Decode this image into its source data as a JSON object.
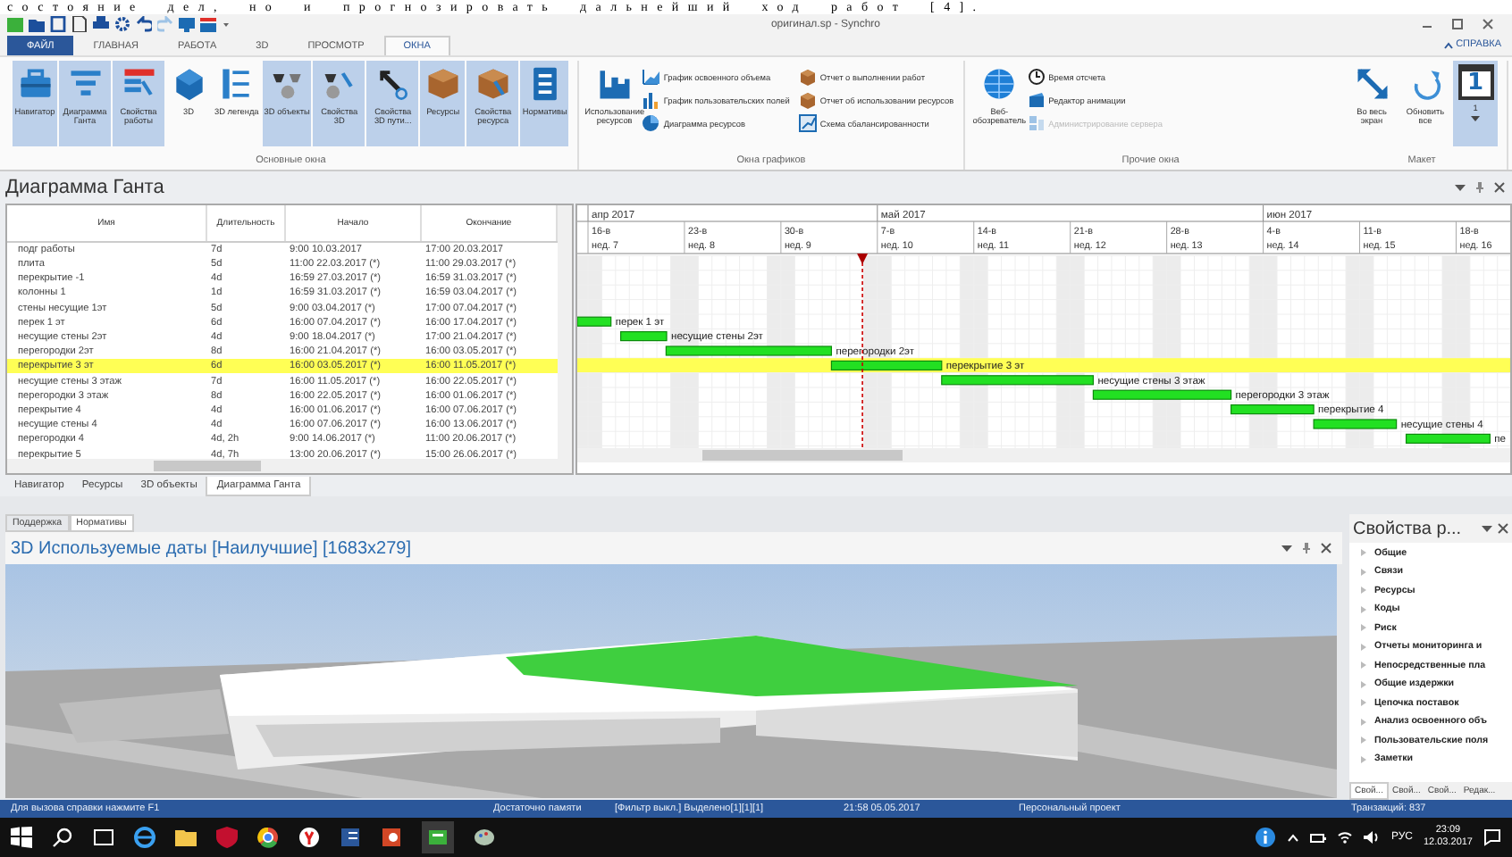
{
  "document_text": "состояние дел, но и прогнозировать дальнейший ход работ [4].",
  "window": {
    "title": "оригинал.sp - Synchro",
    "help": "СПРАВКА"
  },
  "tabs": [
    {
      "label": "ФАЙЛ",
      "kind": "file",
      "selected": false
    },
    {
      "label": "ГЛАВНАЯ",
      "kind": "tab",
      "selected": false
    },
    {
      "label": "РАБОТА",
      "kind": "tab",
      "selected": false
    },
    {
      "label": "3D",
      "kind": "tab",
      "selected": false
    },
    {
      "label": "ПРОСМОТР",
      "kind": "tab",
      "selected": false
    },
    {
      "label": "ОКНА",
      "kind": "tab",
      "selected": true
    }
  ],
  "ribbon": {
    "groups": [
      {
        "title": "Основные окна",
        "buttons": [
          {
            "label": "Навигатор",
            "kind": "large",
            "on": true
          },
          {
            "label": "Диаграмма Ганта",
            "kind": "large",
            "on": true
          },
          {
            "label": "Свойства работы",
            "kind": "large",
            "on": true
          },
          {
            "label": "3D",
            "kind": "large",
            "on": false
          },
          {
            "label": "3D легенда",
            "kind": "large",
            "on": false
          },
          {
            "label": "3D объекты",
            "kind": "large",
            "on": true
          },
          {
            "label": "Свойства 3D",
            "kind": "large",
            "on": true
          },
          {
            "label": "Свойства 3D пути...",
            "kind": "large",
            "on": true
          },
          {
            "label": "Ресурсы",
            "kind": "large",
            "on": true
          },
          {
            "label": "Свойства ресурса",
            "kind": "large",
            "on": true
          },
          {
            "label": "Нормативы",
            "kind": "large",
            "on": true
          }
        ]
      },
      {
        "title": "Окна графиков",
        "buttons": [
          {
            "label": "Использование ресурсов",
            "kind": "large",
            "on": false
          },
          {
            "label": "График освоенного объема",
            "kind": "small",
            "disabled": false
          },
          {
            "label": "График пользовательских полей",
            "kind": "small",
            "disabled": false
          },
          {
            "label": "Диаграмма ресурсов",
            "kind": "small",
            "disabled": false
          },
          {
            "label": "Отчет о выполнении работ",
            "kind": "small",
            "disabled": false
          },
          {
            "label": "Отчет об использовании ресурсов",
            "kind": "small",
            "disabled": false
          },
          {
            "label": "Схема сбалансированности",
            "kind": "small",
            "disabled": false
          }
        ]
      },
      {
        "title": "Прочие окна",
        "buttons": [
          {
            "label": "Веб-обозреватель",
            "kind": "large",
            "on": false
          },
          {
            "label": "Время отсчета",
            "kind": "small",
            "disabled": false
          },
          {
            "label": "Редактор анимации",
            "kind": "small",
            "disabled": false
          },
          {
            "label": "Администрирование сервера",
            "kind": "small",
            "disabled": true
          }
        ]
      },
      {
        "title": "Макет",
        "buttons": [
          {
            "label": "Во весь экран",
            "kind": "large",
            "on": false
          },
          {
            "label": "Обновить все",
            "kind": "large",
            "on": false
          },
          {
            "label": "1",
            "kind": "calendar",
            "icon_text": "1",
            "on": true
          }
        ]
      }
    ]
  },
  "gantt": {
    "title": "Диаграмма Ганта",
    "columns": [
      "Имя",
      "Длительность",
      "Начало",
      "Окончание"
    ],
    "rows": [
      {
        "name": "подг работы",
        "duration": "7d",
        "start": "9:00 10.03.2017",
        "finish": "17:00 20.03.2017",
        "selected": false
      },
      {
        "name": "плита",
        "duration": "5d",
        "start": "11:00 22.03.2017 (*)",
        "finish": "11:00 29.03.2017 (*)",
        "selected": false
      },
      {
        "name": "перекрытие -1",
        "duration": "4d",
        "start": "16:59 27.03.2017 (*)",
        "finish": "16:59 31.03.2017 (*)",
        "selected": false
      },
      {
        "name": "колонны 1",
        "duration": "1d",
        "start": "16:59 31.03.2017 (*)",
        "finish": "16:59 03.04.2017 (*)",
        "selected": false
      },
      {
        "name": "стены несущие 1эт",
        "duration": "5d",
        "start": "9:00 03.04.2017 (*)",
        "finish": "17:00 07.04.2017 (*)",
        "selected": false
      },
      {
        "name": "перек 1 эт",
        "duration": "6d",
        "start": "16:00 07.04.2017 (*)",
        "finish": "16:00 17.04.2017 (*)",
        "selected": false,
        "bar_label": "перек 1 эт"
      },
      {
        "name": "несущие стены 2эт",
        "duration": "4d",
        "start": "9:00 18.04.2017 (*)",
        "finish": "17:00 21.04.2017 (*)",
        "selected": false,
        "bar_label": "несущие стены 2эт"
      },
      {
        "name": "перегородки 2эт",
        "duration": "8d",
        "start": "16:00 21.04.2017 (*)",
        "finish": "16:00 03.05.2017 (*)",
        "selected": false,
        "bar_label": "перегородки 2эт"
      },
      {
        "name": "перекрытие 3 эт",
        "duration": "6d",
        "start": "16:00 03.05.2017 (*)",
        "finish": "16:00 11.05.2017 (*)",
        "selected": true,
        "bar_label": "перекрытие 3 эт"
      },
      {
        "name": "несущие стены 3 этаж",
        "duration": "7d",
        "start": "16:00 11.05.2017 (*)",
        "finish": "16:00 22.05.2017 (*)",
        "selected": false,
        "bar_label": "несущие стены 3 этаж"
      },
      {
        "name": "перегородки 3 этаж",
        "duration": "8d",
        "start": "16:00 22.05.2017 (*)",
        "finish": "16:00 01.06.2017 (*)",
        "selected": false,
        "bar_label": "перегородки 3 этаж"
      },
      {
        "name": "перекрытие 4",
        "duration": "4d",
        "start": "16:00 01.06.2017 (*)",
        "finish": "16:00 07.06.2017 (*)",
        "selected": false,
        "bar_label": "перекрытие 4"
      },
      {
        "name": "несущие стены 4",
        "duration": "4d",
        "start": "16:00 07.06.2017 (*)",
        "finish": "16:00 13.06.2017 (*)",
        "selected": false,
        "bar_label": "несущие стены 4"
      },
      {
        "name": "перегородки 4",
        "duration": "4d, 2h",
        "start": "9:00 14.06.2017 (*)",
        "finish": "11:00 20.06.2017 (*)",
        "selected": false,
        "bar_label": "пе"
      },
      {
        "name": "перекрытие 5",
        "duration": "4d, 7h",
        "start": "13:00 20.06.2017 (*)",
        "finish": "15:00 26.06.2017 (*)",
        "selected": false
      }
    ],
    "timeline": {
      "months": [
        {
          "label": "апр 2017",
          "weeks": [
            {
              "day": "16-в",
              "week": "нед. 7"
            },
            {
              "day": "23-в",
              "week": "нед. 8"
            },
            {
              "day": "30-в",
              "week": "нед. 9"
            }
          ]
        },
        {
          "label": "май 2017",
          "weeks": [
            {
              "day": "7-в",
              "week": "нед. 10"
            },
            {
              "day": "14-в",
              "week": "нед. 11"
            },
            {
              "day": "21-в",
              "week": "нед. 12"
            },
            {
              "day": "28-в",
              "week": "нед. 13"
            }
          ]
        },
        {
          "label": "июн 2017",
          "weeks": [
            {
              "day": "4-в",
              "week": "нед. 14"
            },
            {
              "day": "11-в",
              "week": "нед. 15"
            },
            {
              "day": "18-в",
              "week": "нед. 16"
            }
          ]
        }
      ]
    },
    "tabs": [
      {
        "label": "Навигатор",
        "selected": false
      },
      {
        "label": "Ресурсы",
        "selected": false
      },
      {
        "label": "3D объекты",
        "selected": false
      },
      {
        "label": "Диаграмма Ганта",
        "selected": true
      }
    ]
  },
  "lower_tabs": [
    {
      "label": "Поддержка",
      "selected": false
    },
    {
      "label": "Нормативы",
      "selected": true
    }
  ],
  "view3d": {
    "title": "3D Используемые даты [Наилучшие] [1683x279]"
  },
  "properties": {
    "title": "Свойства р...",
    "items": [
      "Общие",
      "Связи",
      "Ресурсы",
      "Коды",
      "Риск",
      "Отчеты мониторинга и",
      "Непосредственные пла",
      "Общие издержки",
      "Цепочка поставок",
      "Анализ освоенного объ",
      "Пользовательские поля",
      "Заметки"
    ],
    "tabs": [
      {
        "label": "Свой...",
        "selected": true
      },
      {
        "label": "Свой...",
        "selected": false
      },
      {
        "label": "Свой...",
        "selected": false
      },
      {
        "label": "Редак...",
        "selected": false
      }
    ]
  },
  "status_bar": {
    "help": "Для вызова справки нажмите F1",
    "memory": "Достаточно памяти",
    "filter": "[Фильтр выкл.]  Выделено[1][1][1]",
    "datetime": "21:58 05.05.2017",
    "project": "Персональный проект",
    "transactions": "Транзакций: 837"
  },
  "taskbar": {
    "language": "РУС",
    "time": "23:09",
    "date": "12.03.2017"
  }
}
